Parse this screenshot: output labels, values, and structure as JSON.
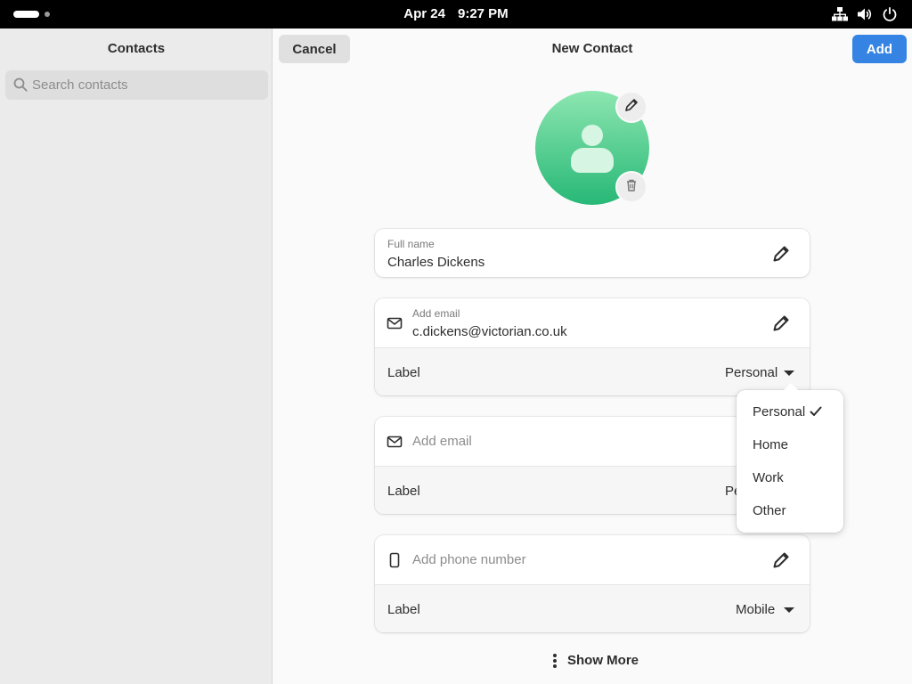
{
  "topbar": {
    "date": "Apr 24",
    "time": "9:27 PM",
    "icons": [
      "network-icon",
      "volume-icon",
      "power-icon"
    ]
  },
  "sidebar": {
    "title": "Contacts",
    "search_placeholder": "Search contacts"
  },
  "header": {
    "cancel_label": "Cancel",
    "title": "New Contact",
    "add_label": "Add"
  },
  "avatar": {
    "edit_icon": "pencil-icon",
    "delete_icon": "trash-icon"
  },
  "name_card": {
    "label": "Full name",
    "value": "Charles Dickens"
  },
  "email_card_1": {
    "label": "Add email",
    "value": "c.dickens@victorian.co.uk",
    "type_label": "Label",
    "type_value": "Personal"
  },
  "email_card_2": {
    "placeholder": "Add email",
    "type_label": "Label",
    "type_value": "Personal",
    "type_value_visible": "Pe"
  },
  "phone_card": {
    "placeholder": "Add phone number",
    "type_label": "Label",
    "type_value": "Mobile"
  },
  "popover": {
    "options": [
      "Personal",
      "Home",
      "Work",
      "Other"
    ],
    "selected": "Personal"
  },
  "footer": {
    "show_more_label": "Show More"
  },
  "colors": {
    "accent": "#3584e4",
    "avatar_top": "#8de6b0",
    "avatar_bottom": "#27b877"
  }
}
